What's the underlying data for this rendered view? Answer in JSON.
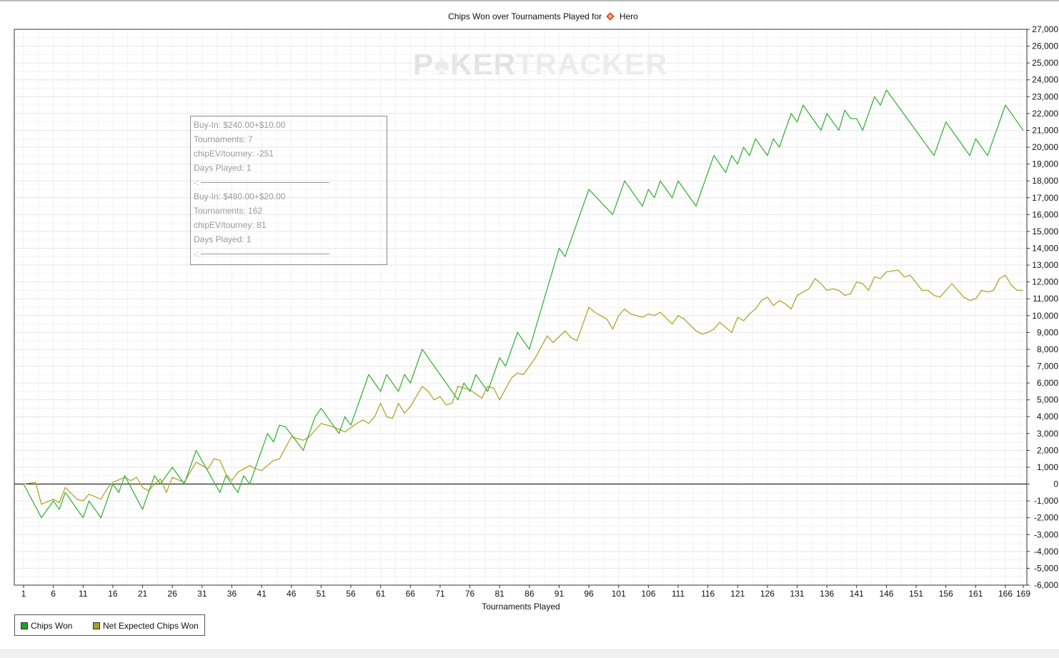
{
  "chart_data": {
    "type": "line",
    "title": "Chips Won over Tournaments Played for",
    "player": "Hero",
    "watermark": {
      "part1": "P",
      "part2": "KER",
      "part3": "TRACKER"
    },
    "xlabel": "Tournaments Played",
    "ylabel": "",
    "xlim": [
      1,
      169
    ],
    "ylim": [
      -6000,
      27000
    ],
    "x_ticks": [
      "1",
      "6",
      "11",
      "16",
      "21",
      "26",
      "31",
      "36",
      "41",
      "46",
      "51",
      "56",
      "61",
      "66",
      "71",
      "76",
      "81",
      "86",
      "91",
      "96",
      "101",
      "106",
      "111",
      "116",
      "121",
      "126",
      "131",
      "136",
      "141",
      "146",
      "151",
      "156",
      "161",
      "166",
      "169"
    ],
    "y_ticks": [
      "27,000",
      "26,000",
      "25,000",
      "24,000",
      "23,000",
      "22,000",
      "21,000",
      "20,000",
      "19,000",
      "18,000",
      "17,000",
      "16,000",
      "15,000",
      "14,000",
      "13,000",
      "12,000",
      "11,000",
      "10,000",
      "9,000",
      "8,000",
      "7,000",
      "6,000",
      "5,000",
      "4,000",
      "3,000",
      "2,000",
      "1,000",
      "0",
      "-1,000",
      "-2,000",
      "-3,000",
      "-4,000",
      "-5,000",
      "-6,000"
    ],
    "grid": true,
    "legend_position": "bottom-left",
    "series": [
      {
        "name": "Chips Won",
        "color": "#3cb33c",
        "points": [
          [
            1,
            0
          ],
          [
            4,
            -2000
          ],
          [
            6,
            -1000
          ],
          [
            7,
            -1500
          ],
          [
            8,
            -500
          ],
          [
            11,
            -2000
          ],
          [
            12,
            -1000
          ],
          [
            14,
            -2000
          ],
          [
            16,
            0
          ],
          [
            17,
            -500
          ],
          [
            18,
            500
          ],
          [
            21,
            -1500
          ],
          [
            23,
            500
          ],
          [
            24,
            0
          ],
          [
            26,
            1000
          ],
          [
            28,
            0
          ],
          [
            30,
            2000
          ],
          [
            34,
            -500
          ],
          [
            35,
            500
          ],
          [
            37,
            -500
          ],
          [
            38,
            500
          ],
          [
            39,
            0
          ],
          [
            42,
            3000
          ],
          [
            43,
            2500
          ],
          [
            44,
            3500
          ],
          [
            45,
            3400
          ],
          [
            48,
            2000
          ],
          [
            50,
            4000
          ],
          [
            51,
            4500
          ],
          [
            54,
            3000
          ],
          [
            55,
            4000
          ],
          [
            56,
            3500
          ],
          [
            59,
            6500
          ],
          [
            61,
            5500
          ],
          [
            62,
            6500
          ],
          [
            64,
            5500
          ],
          [
            65,
            6500
          ],
          [
            66,
            6000
          ],
          [
            68,
            8000
          ],
          [
            74,
            5000
          ],
          [
            75,
            6000
          ],
          [
            76,
            5500
          ],
          [
            77,
            6500
          ],
          [
            79,
            5500
          ],
          [
            81,
            7500
          ],
          [
            82,
            7000
          ],
          [
            84,
            9000
          ],
          [
            86,
            8000
          ],
          [
            91,
            14000
          ],
          [
            92,
            13500
          ],
          [
            96,
            17500
          ],
          [
            100,
            16000
          ],
          [
            102,
            18000
          ],
          [
            105,
            16500
          ],
          [
            106,
            17500
          ],
          [
            107,
            17000
          ],
          [
            108,
            18000
          ],
          [
            110,
            17000
          ],
          [
            111,
            18000
          ],
          [
            114,
            16500
          ],
          [
            117,
            19500
          ],
          [
            119,
            18500
          ],
          [
            120,
            19500
          ],
          [
            121,
            19000
          ],
          [
            122,
            20000
          ],
          [
            123,
            19500
          ],
          [
            124,
            20500
          ],
          [
            126,
            19500
          ],
          [
            127,
            20500
          ],
          [
            128,
            20000
          ],
          [
            130,
            22000
          ],
          [
            131,
            21500
          ],
          [
            132,
            22500
          ],
          [
            135,
            21000
          ],
          [
            136,
            22000
          ],
          [
            138,
            21000
          ],
          [
            139,
            22200
          ],
          [
            140,
            21700
          ],
          [
            141,
            21700
          ],
          [
            142,
            21000
          ],
          [
            144,
            23000
          ],
          [
            145,
            22500
          ],
          [
            146,
            23400
          ],
          [
            154,
            19500
          ],
          [
            156,
            21500
          ],
          [
            160,
            19500
          ],
          [
            161,
            20500
          ],
          [
            163,
            19500
          ],
          [
            166,
            22500
          ],
          [
            169,
            21000
          ]
        ]
      },
      {
        "name": "Net Expected Chips Won",
        "color": "#b0a52a",
        "points": [
          [
            1,
            0
          ],
          [
            3,
            100
          ],
          [
            4,
            -1200
          ],
          [
            6,
            -900
          ],
          [
            7,
            -1100
          ],
          [
            8,
            -200
          ],
          [
            10,
            -900
          ],
          [
            11,
            -1000
          ],
          [
            12,
            -600
          ],
          [
            14,
            -900
          ],
          [
            15,
            -300
          ],
          [
            16,
            100
          ],
          [
            18,
            400
          ],
          [
            19,
            200
          ],
          [
            20,
            400
          ],
          [
            21,
            -200
          ],
          [
            22,
            -400
          ],
          [
            23,
            0
          ],
          [
            24,
            300
          ],
          [
            25,
            -500
          ],
          [
            26,
            400
          ],
          [
            28,
            100
          ],
          [
            30,
            1300
          ],
          [
            32,
            900
          ],
          [
            33,
            1500
          ],
          [
            34,
            1400
          ],
          [
            35,
            600
          ],
          [
            36,
            200
          ],
          [
            37,
            700
          ],
          [
            39,
            1100
          ],
          [
            40,
            900
          ],
          [
            41,
            800
          ],
          [
            43,
            1400
          ],
          [
            44,
            1500
          ],
          [
            46,
            2800
          ],
          [
            48,
            2600
          ],
          [
            49,
            2800
          ],
          [
            51,
            3600
          ],
          [
            53,
            3400
          ],
          [
            55,
            3100
          ],
          [
            57,
            3600
          ],
          [
            58,
            3800
          ],
          [
            59,
            3600
          ],
          [
            60,
            4000
          ],
          [
            61,
            4800
          ],
          [
            62,
            4000
          ],
          [
            63,
            3900
          ],
          [
            64,
            4800
          ],
          [
            65,
            4200
          ],
          [
            66,
            4600
          ],
          [
            68,
            5800
          ],
          [
            69,
            5500
          ],
          [
            70,
            5000
          ],
          [
            71,
            5200
          ],
          [
            72,
            4700
          ],
          [
            73,
            4800
          ],
          [
            74,
            5800
          ],
          [
            76,
            5600
          ],
          [
            78,
            5100
          ],
          [
            79,
            5800
          ],
          [
            80,
            5700
          ],
          [
            81,
            5000
          ],
          [
            83,
            6300
          ],
          [
            84,
            6600
          ],
          [
            85,
            6500
          ],
          [
            87,
            7500
          ],
          [
            89,
            8800
          ],
          [
            90,
            8400
          ],
          [
            92,
            9100
          ],
          [
            93,
            8700
          ],
          [
            94,
            8500
          ],
          [
            96,
            10500
          ],
          [
            97,
            10200
          ],
          [
            99,
            9800
          ],
          [
            100,
            9200
          ],
          [
            101,
            10000
          ],
          [
            102,
            10400
          ],
          [
            103,
            10100
          ],
          [
            105,
            9900
          ],
          [
            106,
            10100
          ],
          [
            107,
            10000
          ],
          [
            108,
            10200
          ],
          [
            110,
            9500
          ],
          [
            111,
            10000
          ],
          [
            112,
            9800
          ],
          [
            114,
            9100
          ],
          [
            115,
            8900
          ],
          [
            116,
            9000
          ],
          [
            117,
            9200
          ],
          [
            118,
            9600
          ],
          [
            120,
            9000
          ],
          [
            121,
            9900
          ],
          [
            122,
            9700
          ],
          [
            123,
            10100
          ],
          [
            124,
            10400
          ],
          [
            125,
            10900
          ],
          [
            126,
            11100
          ],
          [
            127,
            10600
          ],
          [
            128,
            10900
          ],
          [
            129,
            10700
          ],
          [
            130,
            10400
          ],
          [
            131,
            11200
          ],
          [
            133,
            11600
          ],
          [
            134,
            12200
          ],
          [
            135,
            11900
          ],
          [
            136,
            11500
          ],
          [
            137,
            11600
          ],
          [
            138,
            11500
          ],
          [
            139,
            11200
          ],
          [
            140,
            11300
          ],
          [
            141,
            12000
          ],
          [
            142,
            11900
          ],
          [
            143,
            11500
          ],
          [
            144,
            12300
          ],
          [
            145,
            12200
          ],
          [
            146,
            12600
          ],
          [
            148,
            12700
          ],
          [
            149,
            12300
          ],
          [
            150,
            12400
          ],
          [
            152,
            11500
          ],
          [
            153,
            11500
          ],
          [
            154,
            11200
          ],
          [
            155,
            11100
          ],
          [
            157,
            11900
          ],
          [
            159,
            11100
          ],
          [
            160,
            10900
          ],
          [
            161,
            11000
          ],
          [
            162,
            11500
          ],
          [
            163,
            11400
          ],
          [
            164,
            11500
          ],
          [
            165,
            12200
          ],
          [
            166,
            12400
          ],
          [
            167,
            11800
          ],
          [
            168,
            11500
          ],
          [
            169,
            11500
          ]
        ]
      }
    ],
    "annotations": [
      {
        "lines": [
          "Buy-In: $240.00+$10.00",
          "Tournaments: 7",
          "chipEV/tourney: -251",
          "Days Played: 1",
          "-:"
        ]
      },
      {
        "lines": [
          "Buy-In: $480.00+$20.00",
          "Tournaments: 162",
          "chipEV/tourney: 81",
          "Days Played: 1",
          "-:"
        ]
      }
    ],
    "zero_line_color": "#000000",
    "diamond_color": "#e05a1e"
  }
}
